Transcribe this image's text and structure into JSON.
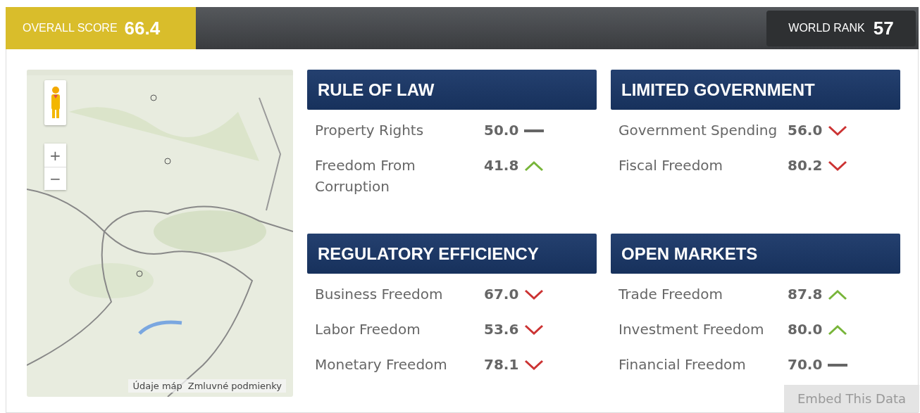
{
  "overall_score": {
    "label": "OVERALL SCORE",
    "value": "66.4"
  },
  "world_rank": {
    "label": "WORLD RANK",
    "value": "57"
  },
  "map": {
    "zoom_in": "+",
    "zoom_out": "−",
    "attribution": [
      "Údaje máp",
      "Zmluvné podmienky"
    ]
  },
  "categories": [
    {
      "title": "RULE OF LAW",
      "items": [
        {
          "name": "Property Rights",
          "score": "50.0",
          "kind": "flat"
        },
        {
          "name": "Freedom From Corruption",
          "score": "41.8",
          "kind": "up"
        }
      ]
    },
    {
      "title": "LIMITED GOVERNMENT",
      "items": [
        {
          "name": "Government Spending",
          "score": "56.0",
          "kind": "down"
        },
        {
          "name": "Fiscal Freedom",
          "score": "80.2",
          "kind": "down"
        }
      ]
    },
    {
      "title": "REGULATORY EFFICIENCY",
      "items": [
        {
          "name": "Business Freedom",
          "score": "67.0",
          "kind": "down"
        },
        {
          "name": "Labor Freedom",
          "score": "53.6",
          "kind": "down"
        },
        {
          "name": "Monetary Freedom",
          "score": "78.1",
          "kind": "down"
        }
      ]
    },
    {
      "title": "OPEN MARKETS",
      "items": [
        {
          "name": "Trade Freedom",
          "score": "87.8",
          "kind": "up"
        },
        {
          "name": "Investment Freedom",
          "score": "80.0",
          "kind": "up"
        },
        {
          "name": "Financial Freedom",
          "score": "70.0",
          "kind": "flat"
        }
      ]
    }
  ],
  "embed_button": "Embed This Data"
}
